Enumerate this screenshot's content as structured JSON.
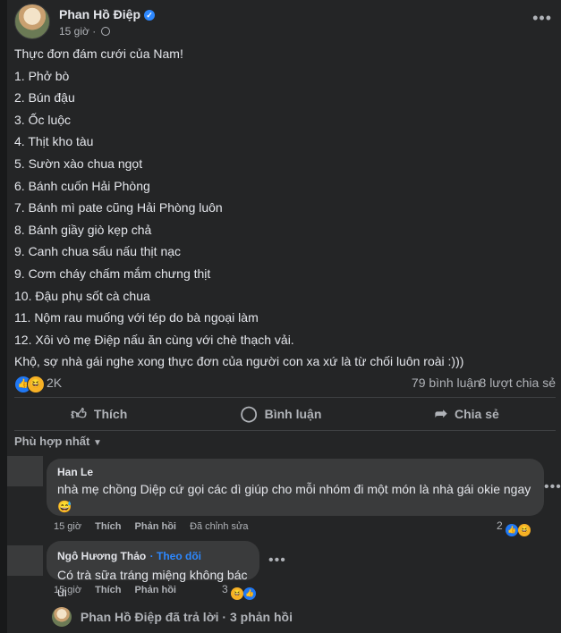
{
  "post": {
    "author": "Phan Hồ Điệp",
    "time": "15 giờ",
    "more": "•••",
    "lines": [
      "Thực đơn đám cưới của Nam!",
      "1. Phở bò",
      "2. Bún đậu",
      "3. Ốc luộc",
      "4. Thịt kho tàu",
      "5. Sườn xào chua ngọt",
      "6. Bánh cuốn Hải Phòng",
      "7. Bánh mì pate cũng Hải Phòng luôn",
      "8. Bánh giầy giò kẹp chả",
      "9. Canh chua sấu nấu thịt nạc",
      "9. Cơm cháy chấm mắm chưng thịt",
      "10. Đậu phụ sốt cà chua",
      "11. Nộm rau muống với tép do bà ngoại làm",
      "12. Xôi vò mẹ Điệp nấu ăn cùng với chè thạch vải.",
      "Khộ, sợ nhà gái nghe xong thực đơn của người con xa xứ là từ chối luôn roài :)))"
    ]
  },
  "stats": {
    "reactions": "2K",
    "comments": "79 bình luận",
    "shares": "8 lượt chia sẻ"
  },
  "actions": {
    "like": "Thích",
    "comment": "Bình luận",
    "share": "Chia sẻ"
  },
  "sort_label": "Phù hợp nhất",
  "comments": [
    {
      "name": "Han Le",
      "text": "nhà mẹ chồng Diệp cứ gọi các dì giúp cho mỗi nhóm đi một món là nhà gái okie ngay",
      "time": "15 giờ",
      "like": "Thích",
      "reply": "Phản hồi",
      "edited": "Đã chỉnh sửa",
      "react_count": "2"
    },
    {
      "name": "Ngô Hương Thảo",
      "follow": "Theo dõi",
      "text": "Có trà sữa tráng miệng không bác ui",
      "time": "15 giờ",
      "like": "Thích",
      "reply": "Phản hồi",
      "react_count": "3"
    }
  ],
  "reply_summary": "Phan Hồ Điệp đã trả lời · 3 phản hồi",
  "colors": {
    "card": "#242526",
    "bubble": "#3a3b3c",
    "text": "#e4e6eb",
    "secondary": "#b0b3b8",
    "accent": "#2d88ff"
  }
}
